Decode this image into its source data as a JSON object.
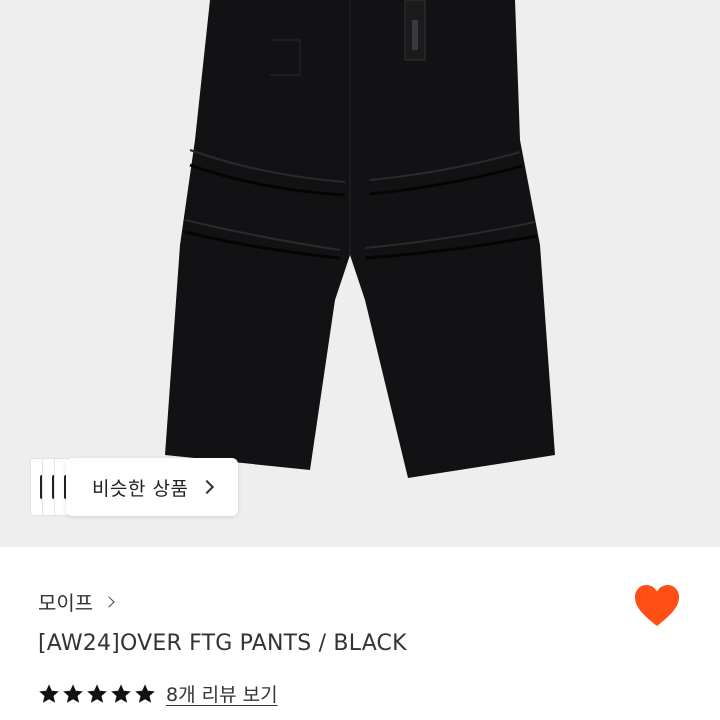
{
  "product_image": {
    "background": "#eeeeef",
    "garment_color": "#121214"
  },
  "similar_products": {
    "label": "비슷한 상품",
    "chevron_icon": "chevron-right-icon"
  },
  "product": {
    "brand": "모이프",
    "brand_chevron_icon": "chevron-right-icon",
    "title": "[AW24]OVER FTG PANTS / BLACK",
    "wishlist_icon": "heart-icon",
    "wishlist_color": "#ff4f14",
    "rating": {
      "stars": 5,
      "max_stars": 5,
      "star_icon": "star-icon",
      "review_link": "8개 리뷰 보기"
    }
  }
}
